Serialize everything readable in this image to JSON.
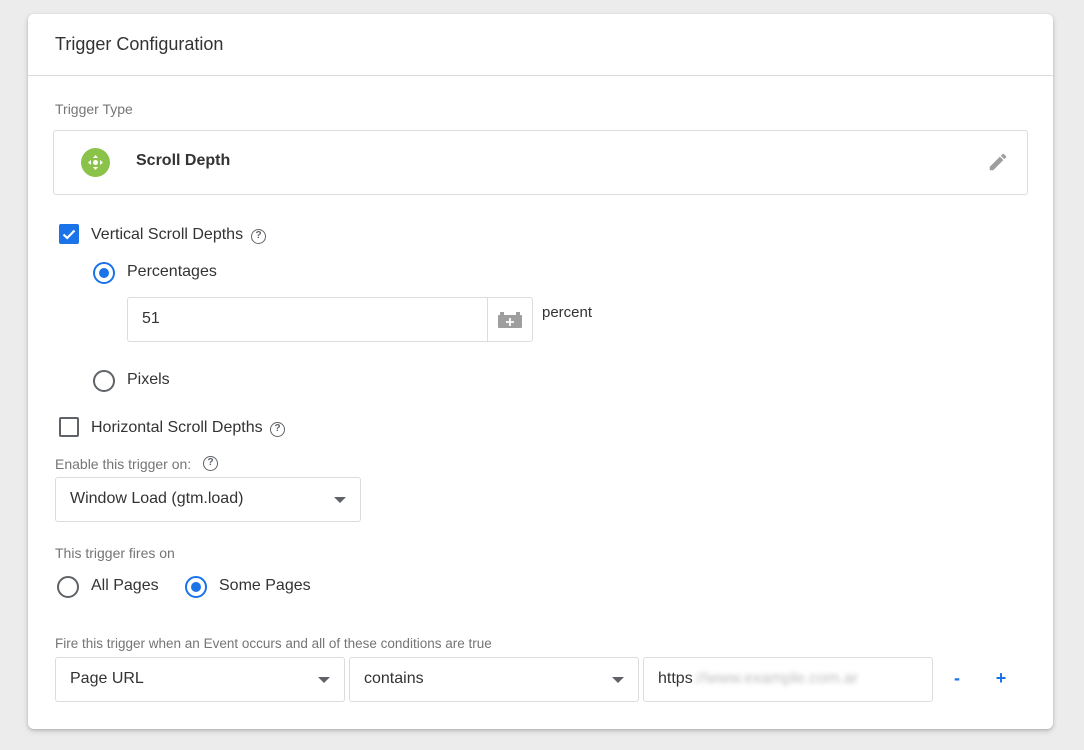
{
  "header": {
    "title": "Trigger Configuration"
  },
  "trigger_type": {
    "label": "Trigger Type",
    "name": "Scroll Depth",
    "icon": "scroll-depth-icon",
    "icon_color": "#8bc34a"
  },
  "vertical": {
    "label": "Vertical Scroll Depths",
    "checked": true,
    "options": {
      "percentages": {
        "label": "Percentages",
        "selected": true
      },
      "pixels": {
        "label": "Pixels",
        "selected": false
      }
    },
    "value": "51",
    "unit": "percent"
  },
  "horizontal": {
    "label": "Horizontal Scroll Depths",
    "checked": false
  },
  "enable_on": {
    "label": "Enable this trigger on:",
    "selected": "Window Load (gtm.load)"
  },
  "fires_on": {
    "label": "This trigger fires on",
    "options": {
      "all_pages": {
        "label": "All Pages",
        "selected": false
      },
      "some_pages": {
        "label": "Some Pages",
        "selected": true
      }
    }
  },
  "condition": {
    "label": "Fire this trigger when an Event occurs and all of these conditions are true",
    "variable": "Page URL",
    "operator": "contains",
    "value_visible": "https",
    "remove_label": "-",
    "add_label": "+"
  },
  "colors": {
    "accent": "#1a73e8",
    "border": "#dadce0",
    "muted": "#757575"
  }
}
